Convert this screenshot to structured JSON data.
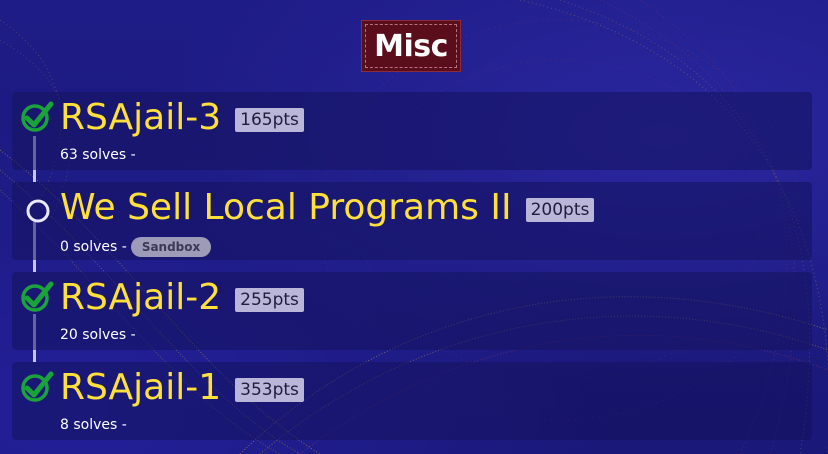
{
  "category": {
    "name": "Misc"
  },
  "challenges": [
    {
      "title": "RSAjail-3",
      "points": "165pts",
      "solves": "63 solves -",
      "tag": "",
      "status": "solved",
      "status_icon": "check-icon"
    },
    {
      "title": "We Sell Local Programs II",
      "points": "200pts",
      "solves": "0 solves -",
      "tag": "Sandbox",
      "status": "unsolved",
      "status_icon": "circle-icon"
    },
    {
      "title": "RSAjail-2",
      "points": "255pts",
      "solves": "20 solves -",
      "tag": "",
      "status": "solved",
      "status_icon": "check-icon"
    },
    {
      "title": "RSAjail-1",
      "points": "353pts",
      "solves": "8 solves -",
      "tag": "",
      "status": "solved",
      "status_icon": "check-icon"
    }
  ],
  "colors": {
    "background": "#1d1b80",
    "title": "#ffe03a",
    "category_bg": "#5a0d1a",
    "solved_check": "#1aa33a",
    "points_badge": "#b9b6d9"
  }
}
